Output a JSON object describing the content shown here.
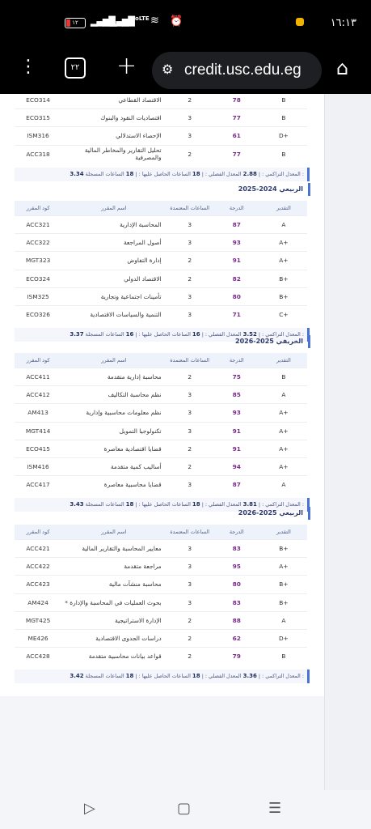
{
  "status_bar": {
    "time": "١٦:١٣",
    "battery": "١٢",
    "network": "VoLTE"
  },
  "browser": {
    "tabs_count": "٢٢",
    "url": "credit.usc.edu.eg"
  },
  "headers": {
    "grade": "التقدير",
    "degree": "الدرجة",
    "hours": "الساعات المعتمدة",
    "course_name": "اسم المقرر",
    "course_code": "كود المقرر"
  },
  "summary_labels": {
    "registered": "الساعات المسجلة :",
    "earned": "الساعات الحاصل عليها :",
    "gpa": "المعدل الفصلي :",
    "cgpa": "المعدل التراكمي :"
  },
  "semesters": [
    {
      "title": "",
      "rows": [
        {
          "code": "ECO314",
          "name": "الاقتصاد القطاعي",
          "hours": "2",
          "degree": "78",
          "grade": "B"
        },
        {
          "code": "ECO315",
          "name": "اقتصاديات النقود والبنوك",
          "hours": "3",
          "degree": "77",
          "grade": "B"
        },
        {
          "code": "ISM316",
          "name": "الإحصاء الاستدلالي",
          "hours": "3",
          "degree": "61",
          "grade": "D+"
        },
        {
          "code": "ACC318",
          "name": "تحليل التقارير والمخاطر المالية والمصرفية",
          "hours": "2",
          "degree": "77",
          "grade": "B"
        }
      ],
      "summary": {
        "registered": "18",
        "earned": "18",
        "gpa": "2.88",
        "cgpa": "3.34"
      }
    },
    {
      "title": "الربيعي 2024-2025",
      "rows": [
        {
          "code": "ACC321",
          "name": "المحاسبة الإدارية",
          "hours": "3",
          "degree": "87",
          "grade": "A"
        },
        {
          "code": "ACC322",
          "name": "أصول المراجعة",
          "hours": "3",
          "degree": "93",
          "grade": "A+"
        },
        {
          "code": "MGT323",
          "name": "إدارة التفاوض",
          "hours": "2",
          "degree": "91",
          "grade": "A+"
        },
        {
          "code": "ECO324",
          "name": "الاقتصاد الدولي",
          "hours": "2",
          "degree": "82",
          "grade": "B+"
        },
        {
          "code": "ISM325",
          "name": "تأمينات اجتماعية وتجارية",
          "hours": "3",
          "degree": "80",
          "grade": "B+"
        },
        {
          "code": "ECO326",
          "name": "التنمية والسياسات الاقتصادية",
          "hours": "3",
          "degree": "71",
          "grade": "C+"
        }
      ],
      "summary": {
        "registered": "16",
        "earned": "16",
        "gpa": "3.52",
        "cgpa": "3.37"
      }
    },
    {
      "title": "الخريفي 2025-2026",
      "rows": [
        {
          "code": "ACC411",
          "name": "محاسبة إدارية متقدمة",
          "hours": "2",
          "degree": "75",
          "grade": "B"
        },
        {
          "code": "ACC412",
          "name": "نظم محاسبة التكاليف",
          "hours": "3",
          "degree": "85",
          "grade": "A"
        },
        {
          "code": "AM413",
          "name": "نظم معلومات محاسبية وإدارية",
          "hours": "3",
          "degree": "93",
          "grade": "A+"
        },
        {
          "code": "MGT414",
          "name": "تكنولوجيا التمويل",
          "hours": "3",
          "degree": "91",
          "grade": "A+"
        },
        {
          "code": "ECO415",
          "name": "قضايا اقتصادية معاصرة",
          "hours": "2",
          "degree": "91",
          "grade": "A+"
        },
        {
          "code": "ISM416",
          "name": "أساليب كمية متقدمة",
          "hours": "2",
          "degree": "94",
          "grade": "A+"
        },
        {
          "code": "ACC417",
          "name": "قضايا محاسبية معاصرة",
          "hours": "3",
          "degree": "87",
          "grade": "A"
        }
      ],
      "summary": {
        "registered": "18",
        "earned": "18",
        "gpa": "3.81",
        "cgpa": "3.43"
      }
    },
    {
      "title": "الربيعي 2025-2026",
      "rows": [
        {
          "code": "ACC421",
          "name": "معايير المحاسبة والتقارير المالية",
          "hours": "3",
          "degree": "83",
          "grade": "B+"
        },
        {
          "code": "ACC422",
          "name": "مراجعة متقدمة",
          "hours": "3",
          "degree": "95",
          "grade": "A+"
        },
        {
          "code": "ACC423",
          "name": "محاسبة منشآت مالية",
          "hours": "3",
          "degree": "80",
          "grade": "B+"
        },
        {
          "code": "AM424",
          "name": "* بحوث العمليات في المحاسبة والإدارة",
          "hours": "3",
          "degree": "83",
          "grade": "B+"
        },
        {
          "code": "MGT425",
          "name": "الإدارة الاستراتيجية",
          "hours": "2",
          "degree": "88",
          "grade": "A"
        },
        {
          "code": "ME426",
          "name": "دراسات الجدوى الاقتصادية",
          "hours": "2",
          "degree": "62",
          "grade": "D+"
        },
        {
          "code": "ACC428",
          "name": "قواعد بيانات محاسبية متقدمة",
          "hours": "2",
          "degree": "79",
          "grade": "B"
        }
      ],
      "summary": {
        "registered": "18",
        "earned": "18",
        "gpa": "3.36",
        "cgpa": "3.42"
      }
    }
  ],
  "nav": {
    "back_icon": "triangle-back-icon",
    "home_icon": "square-home-icon",
    "recents_icon": "lines-recents-icon"
  }
}
